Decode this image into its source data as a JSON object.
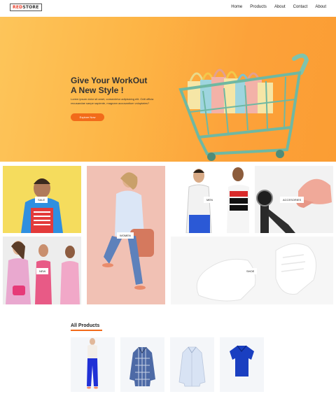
{
  "nav": {
    "logo_red": "RED",
    "logo_dark": "STORE",
    "items": [
      "Home",
      "Products",
      "About",
      "Contact",
      "About"
    ]
  },
  "hero": {
    "headline_line1": "Give Your WorkOut",
    "headline_line2": "A New Style !",
    "body": "Lorem ipsum dolor sit amet, consectetur adipisicing elit. Odit officia recusandae saepe sapiente, magnam accusantium voluptates?",
    "cta_label": "Explore Now"
  },
  "categories": {
    "sale": "SALE",
    "women": "WOMEN",
    "men": "MEN",
    "accessories": "ACCESORIES",
    "new": "NEW",
    "shoe": "SHOE"
  },
  "products": {
    "title": "All Products"
  },
  "colors": {
    "accent": "#f26b1a",
    "logo_red": "#e8412d",
    "hero_orange": "#fca23a",
    "product_bg": "#f4f6f9"
  }
}
